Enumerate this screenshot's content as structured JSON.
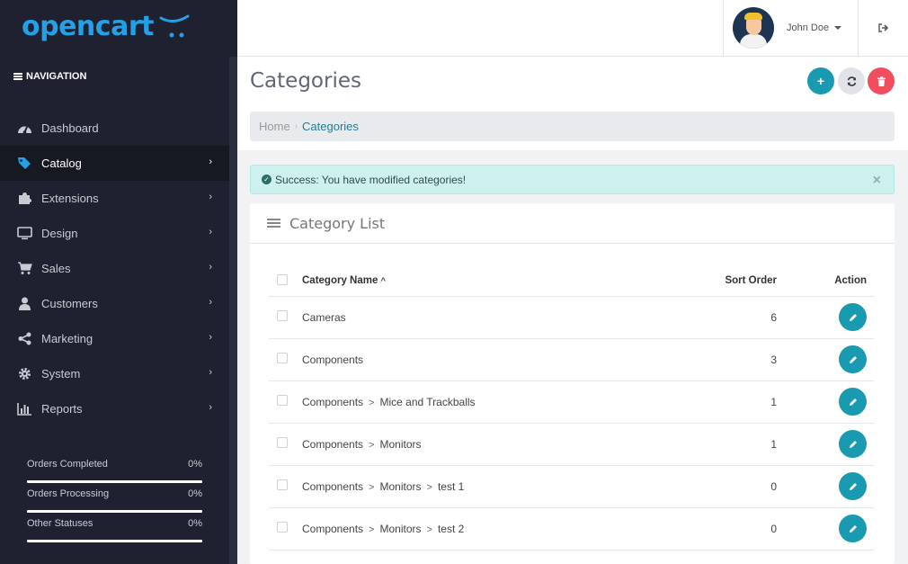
{
  "brand": {
    "logo_text": "opencart",
    "accent": "#23a1e6"
  },
  "sidebar": {
    "heading": "NAVIGATION",
    "items": [
      {
        "label": "Dashboard",
        "icon": "dashboard-icon",
        "active": false
      },
      {
        "label": "Catalog",
        "icon": "tag-icon",
        "active": true
      },
      {
        "label": "Extensions",
        "icon": "puzzle-icon",
        "active": false
      },
      {
        "label": "Design",
        "icon": "monitor-icon",
        "active": false
      },
      {
        "label": "Sales",
        "icon": "cart-icon",
        "active": false
      },
      {
        "label": "Customers",
        "icon": "user-icon",
        "active": false
      },
      {
        "label": "Marketing",
        "icon": "share-icon",
        "active": false
      },
      {
        "label": "System",
        "icon": "gear-icon",
        "active": false
      },
      {
        "label": "Reports",
        "icon": "bar-chart-icon",
        "active": false
      }
    ],
    "stats": [
      {
        "label": "Orders Completed",
        "value": "0%"
      },
      {
        "label": "Orders Processing",
        "value": "0%"
      },
      {
        "label": "Other Statuses",
        "value": "0%"
      }
    ]
  },
  "header": {
    "user_name": "John Doe"
  },
  "page": {
    "title": "Categories",
    "breadcrumb": {
      "home": "Home",
      "current": "Categories"
    }
  },
  "alert": {
    "text": "Success: You have modified categories!",
    "close": "×"
  },
  "card": {
    "title": "Category List",
    "columns": {
      "name": "Category Name",
      "sort_order": "Sort Order",
      "action": "Action"
    },
    "rows": [
      {
        "path": [
          "Cameras"
        ],
        "sort_order": "6"
      },
      {
        "path": [
          "Components"
        ],
        "sort_order": "3"
      },
      {
        "path": [
          "Components",
          "Mice and Trackballs"
        ],
        "sort_order": "1"
      },
      {
        "path": [
          "Components",
          "Monitors"
        ],
        "sort_order": "1"
      },
      {
        "path": [
          "Components",
          "Monitors",
          "test 1"
        ],
        "sort_order": "0"
      },
      {
        "path": [
          "Components",
          "Monitors",
          "test 2"
        ],
        "sort_order": "0"
      }
    ]
  },
  "colors": {
    "primary": "#1a9ab0",
    "danger": "#f04e5e",
    "sidebar_bg": "#1f2130"
  }
}
